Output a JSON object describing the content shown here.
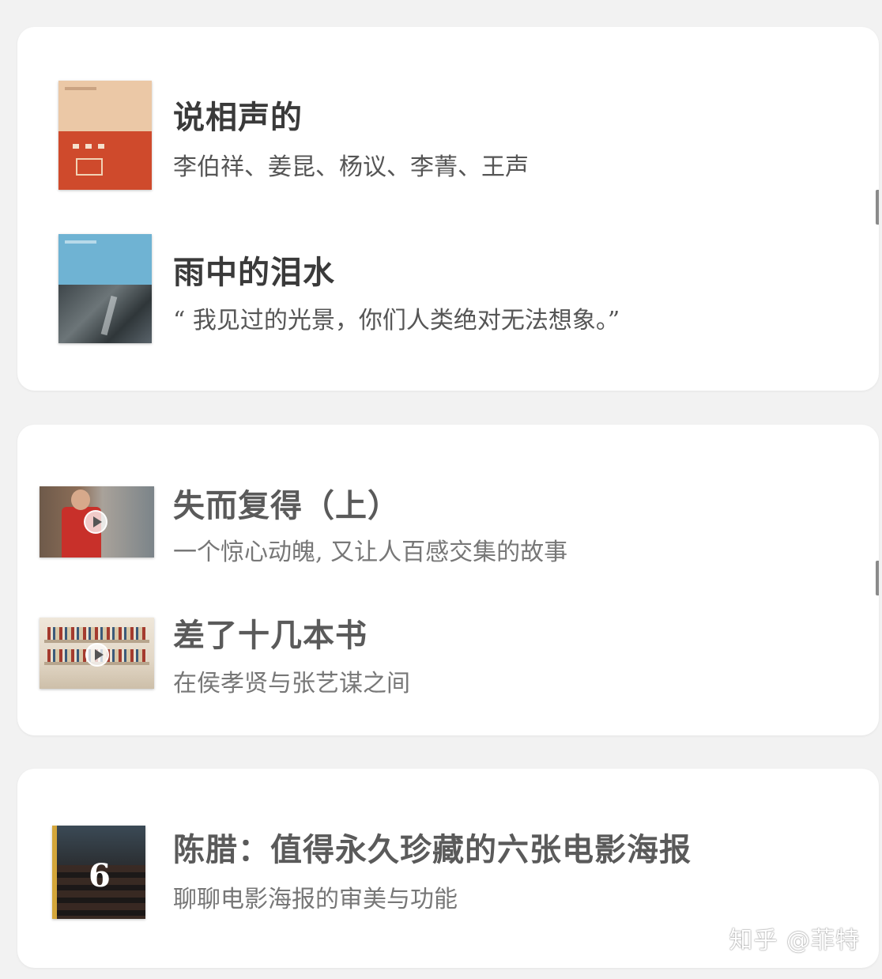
{
  "sections": [
    {
      "items": [
        {
          "title": "说相声的",
          "subtitle": "李伯祥、姜昆、杨议、李菁、王声",
          "thumb_icon": "book-cover-icon"
        },
        {
          "title": "雨中的泪水",
          "subtitle": "“ 我见过的光景，你们人类绝对无法想象。”",
          "thumb_icon": "book-cover-icon"
        }
      ]
    },
    {
      "items": [
        {
          "title": "失而复得（上）",
          "subtitle": "一个惊心动魄, 又让人百感交集的故事",
          "thumb_icon": "video-thumbnail-icon"
        },
        {
          "title": "差了十几本书",
          "subtitle": "在侯孝贤与张艺谋之间",
          "thumb_icon": "video-thumbnail-icon"
        }
      ]
    },
    {
      "items": [
        {
          "title": "陈腊：值得永久珍藏的六张电影海报",
          "subtitle": "聊聊电影海报的审美与功能",
          "thumb_number": "6",
          "thumb_icon": "ebook-cover-icon"
        }
      ]
    }
  ],
  "watermark": "知乎 @菲特",
  "colors": {
    "background": "#f2f2f2",
    "card": "#ffffff",
    "title": "#3a3a3a",
    "subtitle": "#555555"
  }
}
